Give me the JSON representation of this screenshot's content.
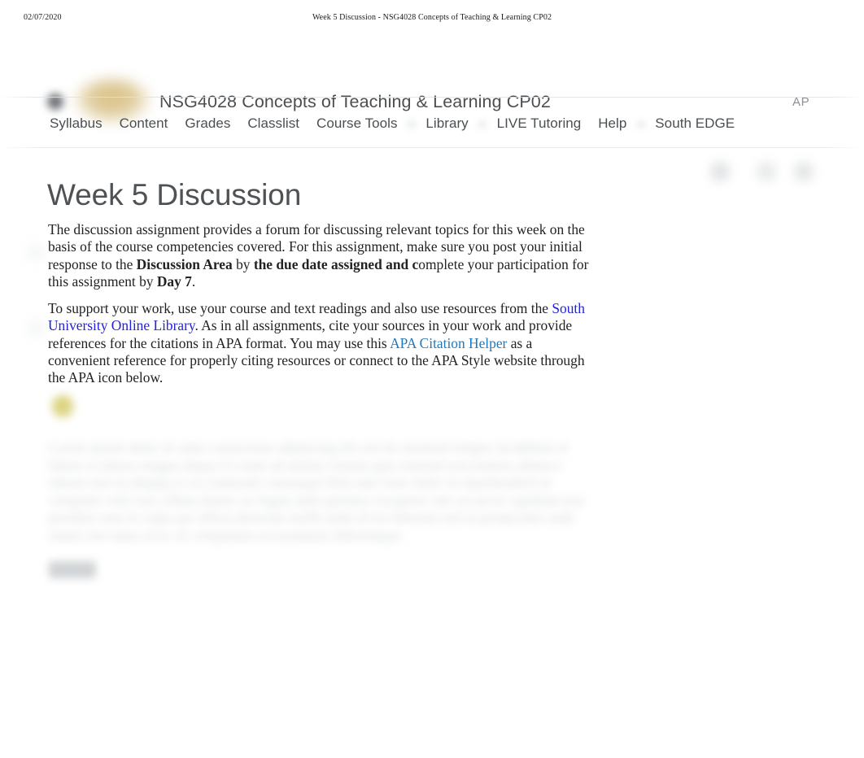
{
  "print_header": {
    "date": "02/07/2020",
    "title": "Week 5 Discussion - NSG4028 Concepts of Teaching & Learning CP02"
  },
  "header": {
    "hamburger_icon": "hamburger-menu-icon",
    "logo_icon": "school-logo-icon",
    "course_title": "NSG4028 Concepts of Teaching & Learning CP02",
    "user_initials": "AP",
    "icons": [
      {
        "name": "message-alerts-icon"
      },
      {
        "name": "subscription-alerts-icon"
      },
      {
        "name": "update-alerts-icon"
      },
      {
        "name": "user-profile-icon"
      }
    ]
  },
  "nav": {
    "items": [
      {
        "label": "Syllabus"
      },
      {
        "label": "Content"
      },
      {
        "label": "Grades"
      },
      {
        "label": "Classlist"
      },
      {
        "label": "Course Tools"
      },
      {
        "label": "Library"
      },
      {
        "label": "LIVE Tutoring"
      },
      {
        "label": "Help"
      },
      {
        "label": "South EDGE"
      }
    ]
  },
  "page": {
    "title": "Week 5 Discussion",
    "action_icons": [
      {
        "name": "print-icon"
      },
      {
        "name": "settings-icon"
      },
      {
        "name": "more-options-icon"
      }
    ]
  },
  "content": {
    "paragraph1": {
      "t1": "The discussion assignment provides a forum for discussing relevant topics for this week on the basis of the course competencies covered. For this assignment, make sure you post your initial response to the ",
      "b1": "Discussion Area",
      "t2": " by ",
      "b2": "the due date assigned and c",
      "t3": "omplete your participation for this assignment by ",
      "b3": "Day 7",
      "t4": "."
    },
    "paragraph2": {
      "t1": "To support your work, use your course and text readings and also use resources from the ",
      "link1": "South University Online Library",
      "t2": ". As in all assignments, cite your sources in your work and provide references for the citations in APA format. You may use this ",
      "link2": "APA Citation Helper",
      "t3": " as a convenient reference for properly citing resources or connect to the APA Style website through the APA icon below."
    },
    "apa_icon_name": "apa-style-icon",
    "redacted_paragraph": "Lorem ipsum dolor sit amet consectetur adipiscing elit sed do eiusmod tempor incididunt ut labore et dolore magna aliqua Ut enim ad minim veniam quis nostrud exercitation ullamco laboris nisi ut aliquip ex ea commodo consequat Duis aute irure dolor in reprehenderit in voluptate velit esse cillum dolore eu fugiat nulla pariatur excepteur sint occaecat cupidatat non proident sunt in culpa qui officia deserunt mollit anim id est laborum sed ut perspiciatis unde omnis iste natus error sit voluptatem accusantium doloremque.",
    "redacted_button_label": ""
  }
}
